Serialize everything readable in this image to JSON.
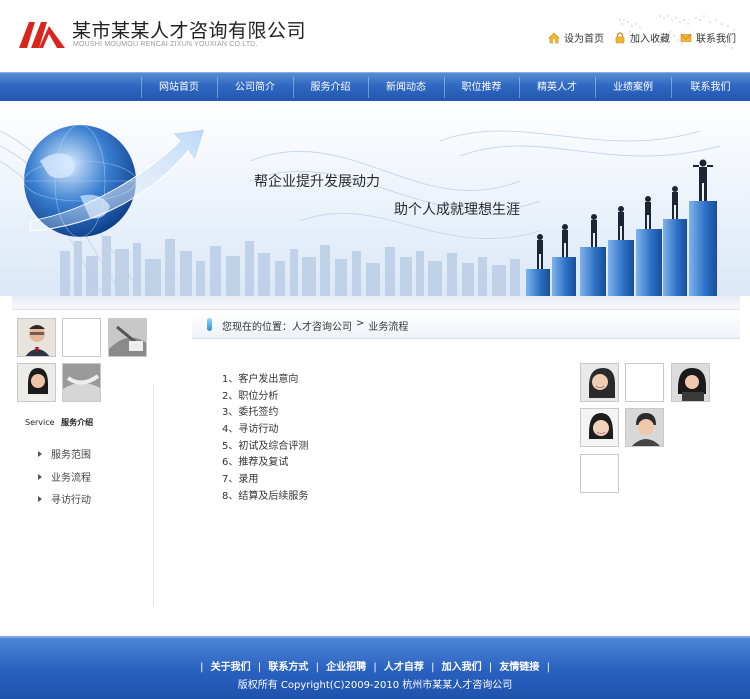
{
  "header": {
    "company_name": "某市某某人才咨询有限公司",
    "company_name_en": "MOUSHI MOUMOU RENCAI ZIXUN YOUXIAN CO.LTD.",
    "links": [
      {
        "label": "设为首页",
        "icon": "home-icon"
      },
      {
        "label": "加入收藏",
        "icon": "lock-icon"
      },
      {
        "label": "联系我们",
        "icon": "envelope-icon"
      }
    ]
  },
  "nav": {
    "items": [
      "网站首页",
      "公司简介",
      "服务介绍",
      "新闻动态",
      "职位推荐",
      "精英人才",
      "业绩案例",
      "联系我们"
    ]
  },
  "banner": {
    "slogan1": "帮企业提升发展动力",
    "slogan2": "助个人成就理想生涯"
  },
  "sidebar": {
    "title_en": "Service",
    "title_cn": "服务介绍",
    "items": [
      "服务范围",
      "业务流程",
      "寻访行动"
    ]
  },
  "breadcrumb": {
    "prefix": "您现在的位置：",
    "home": "人才咨询公司",
    "sep": ">",
    "current": "业务流程"
  },
  "steps": [
    "1、客户发出意向",
    "2、职位分析",
    "3、委托签约",
    "4、寻访行动",
    "5、初试及综合评测",
    "6、推荐及复试",
    "7、录用",
    "8、结算及后续服务"
  ],
  "footer": {
    "links": [
      "关于我们",
      "联系方式",
      "企业招聘",
      "人才自荐",
      "加入我们",
      "友情链接"
    ],
    "separator": "|",
    "copyright": "版权所有 Copyright(C)2009-2010 杭州市某某人才咨询公司"
  },
  "colors": {
    "nav_blue": "#2f67c1",
    "footer_blue": "#2960c0",
    "logo_red": "#d8261f"
  }
}
